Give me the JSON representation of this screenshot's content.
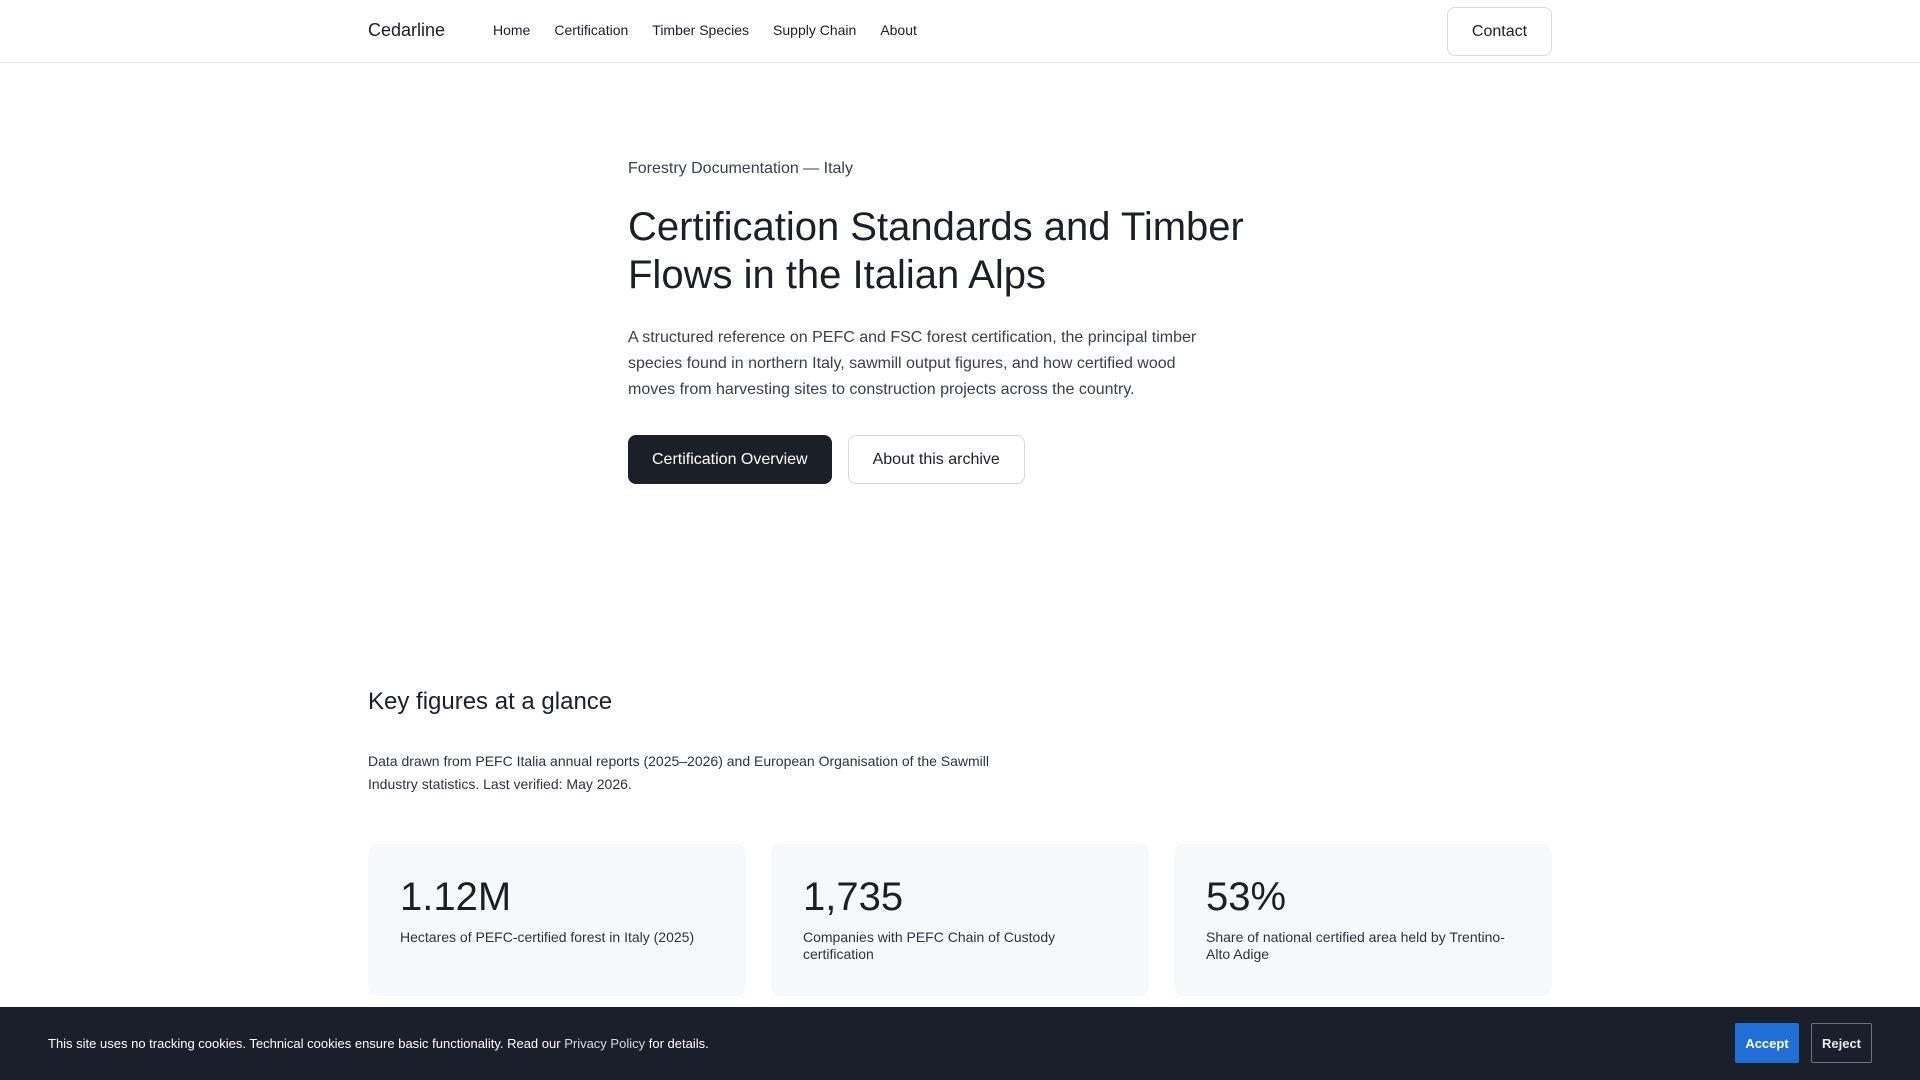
{
  "header": {
    "brand": "Cedarline",
    "nav": [
      "Home",
      "Certification",
      "Timber Species",
      "Supply Chain",
      "About"
    ],
    "contact_label": "Contact"
  },
  "hero": {
    "eyebrow": "Forestry Documentation — Italy",
    "title": "Certification Standards and Timber Flows in the Italian Alps",
    "description": "A structured reference on PEFC and FSC forest certification, the principal timber species found in northern Italy, sawmill output figures, and how certified wood moves from harvesting sites to construction projects across the country.",
    "primary_label": "Certification Overview",
    "secondary_label": "About this archive"
  },
  "figures": {
    "title": "Key figures at a glance",
    "note": "Data drawn from PEFC Italia annual reports (2025–2026) and European Organisation of the Sawmill Industry statistics. Last verified: May 2026.",
    "cards": [
      {
        "value": "1.12M",
        "label": "Hectares of PEFC-certified forest in Italy (2025)"
      },
      {
        "value": "1,735",
        "label": "Companies with PEFC Chain of Custody certification"
      },
      {
        "value": "53%",
        "label": "Share of national certified area held by Trentino-Alto Adige"
      }
    ]
  },
  "cookie": {
    "text_before": "This site uses no tracking cookies. Technical cookies ensure basic functionality. Read our ",
    "link_text": "Privacy Policy",
    "text_after": " for details.",
    "accept_label": "Accept",
    "reject_label": "Reject"
  },
  "colors": {
    "primary_button": "#1b1f27",
    "cookie_background": "#1b1f2a",
    "accept_button": "#1f6fd6",
    "card_background": "#f7f8fa"
  }
}
